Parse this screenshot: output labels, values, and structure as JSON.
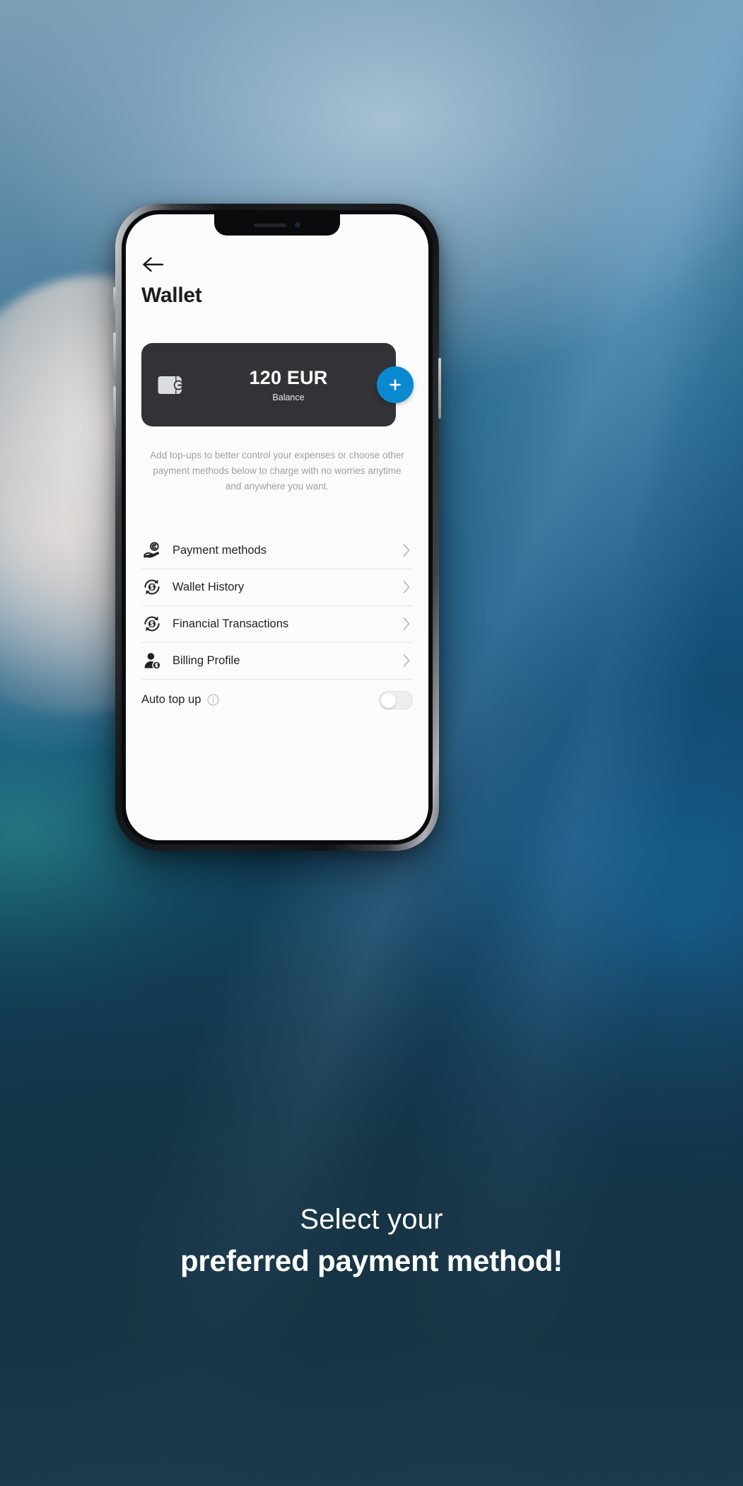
{
  "background": {
    "scene_description": "blurred photo of a hand holding a phone inside a car, blue tones",
    "bottom_color": "#1b3b4d"
  },
  "phone": {
    "notch": {
      "speaker": "speaker-grille",
      "camera": "front-camera"
    },
    "buttons": [
      "mute-switch",
      "volume-up",
      "volume-down",
      "power"
    ]
  },
  "app": {
    "back_icon": "back-arrow-icon",
    "title": "Wallet",
    "balance_card": {
      "icon": "wallet-icon",
      "amount": "120 EUR",
      "label": "Balance",
      "add_button": {
        "icon": "plus-icon",
        "color": "#0b89d0"
      },
      "background": "#323336"
    },
    "helper_text": "Add top-ups to better control your expenses or choose other payment methods below to charge with no worries anytime and anywhere you want.",
    "menu": [
      {
        "icon": "hand-holding-euro-coin-icon",
        "label": "Payment methods",
        "chevron": "chevron-right-icon"
      },
      {
        "icon": "dollar-refresh-circle-icon",
        "label": "Wallet History",
        "chevron": "chevron-right-icon"
      },
      {
        "icon": "dollar-refresh-circle-icon",
        "label": "Financial Transactions",
        "chevron": "chevron-right-icon"
      },
      {
        "icon": "user-dollar-badge-icon",
        "label": "Billing Profile",
        "chevron": "chevron-right-icon"
      }
    ],
    "auto_top_up": {
      "label": "Auto top up",
      "info_icon": "info-circle-icon",
      "toggle": {
        "name": "auto-top-up-toggle",
        "state": "off"
      }
    }
  },
  "caption": {
    "line1": "Select your",
    "line2": "preferred payment method!"
  }
}
